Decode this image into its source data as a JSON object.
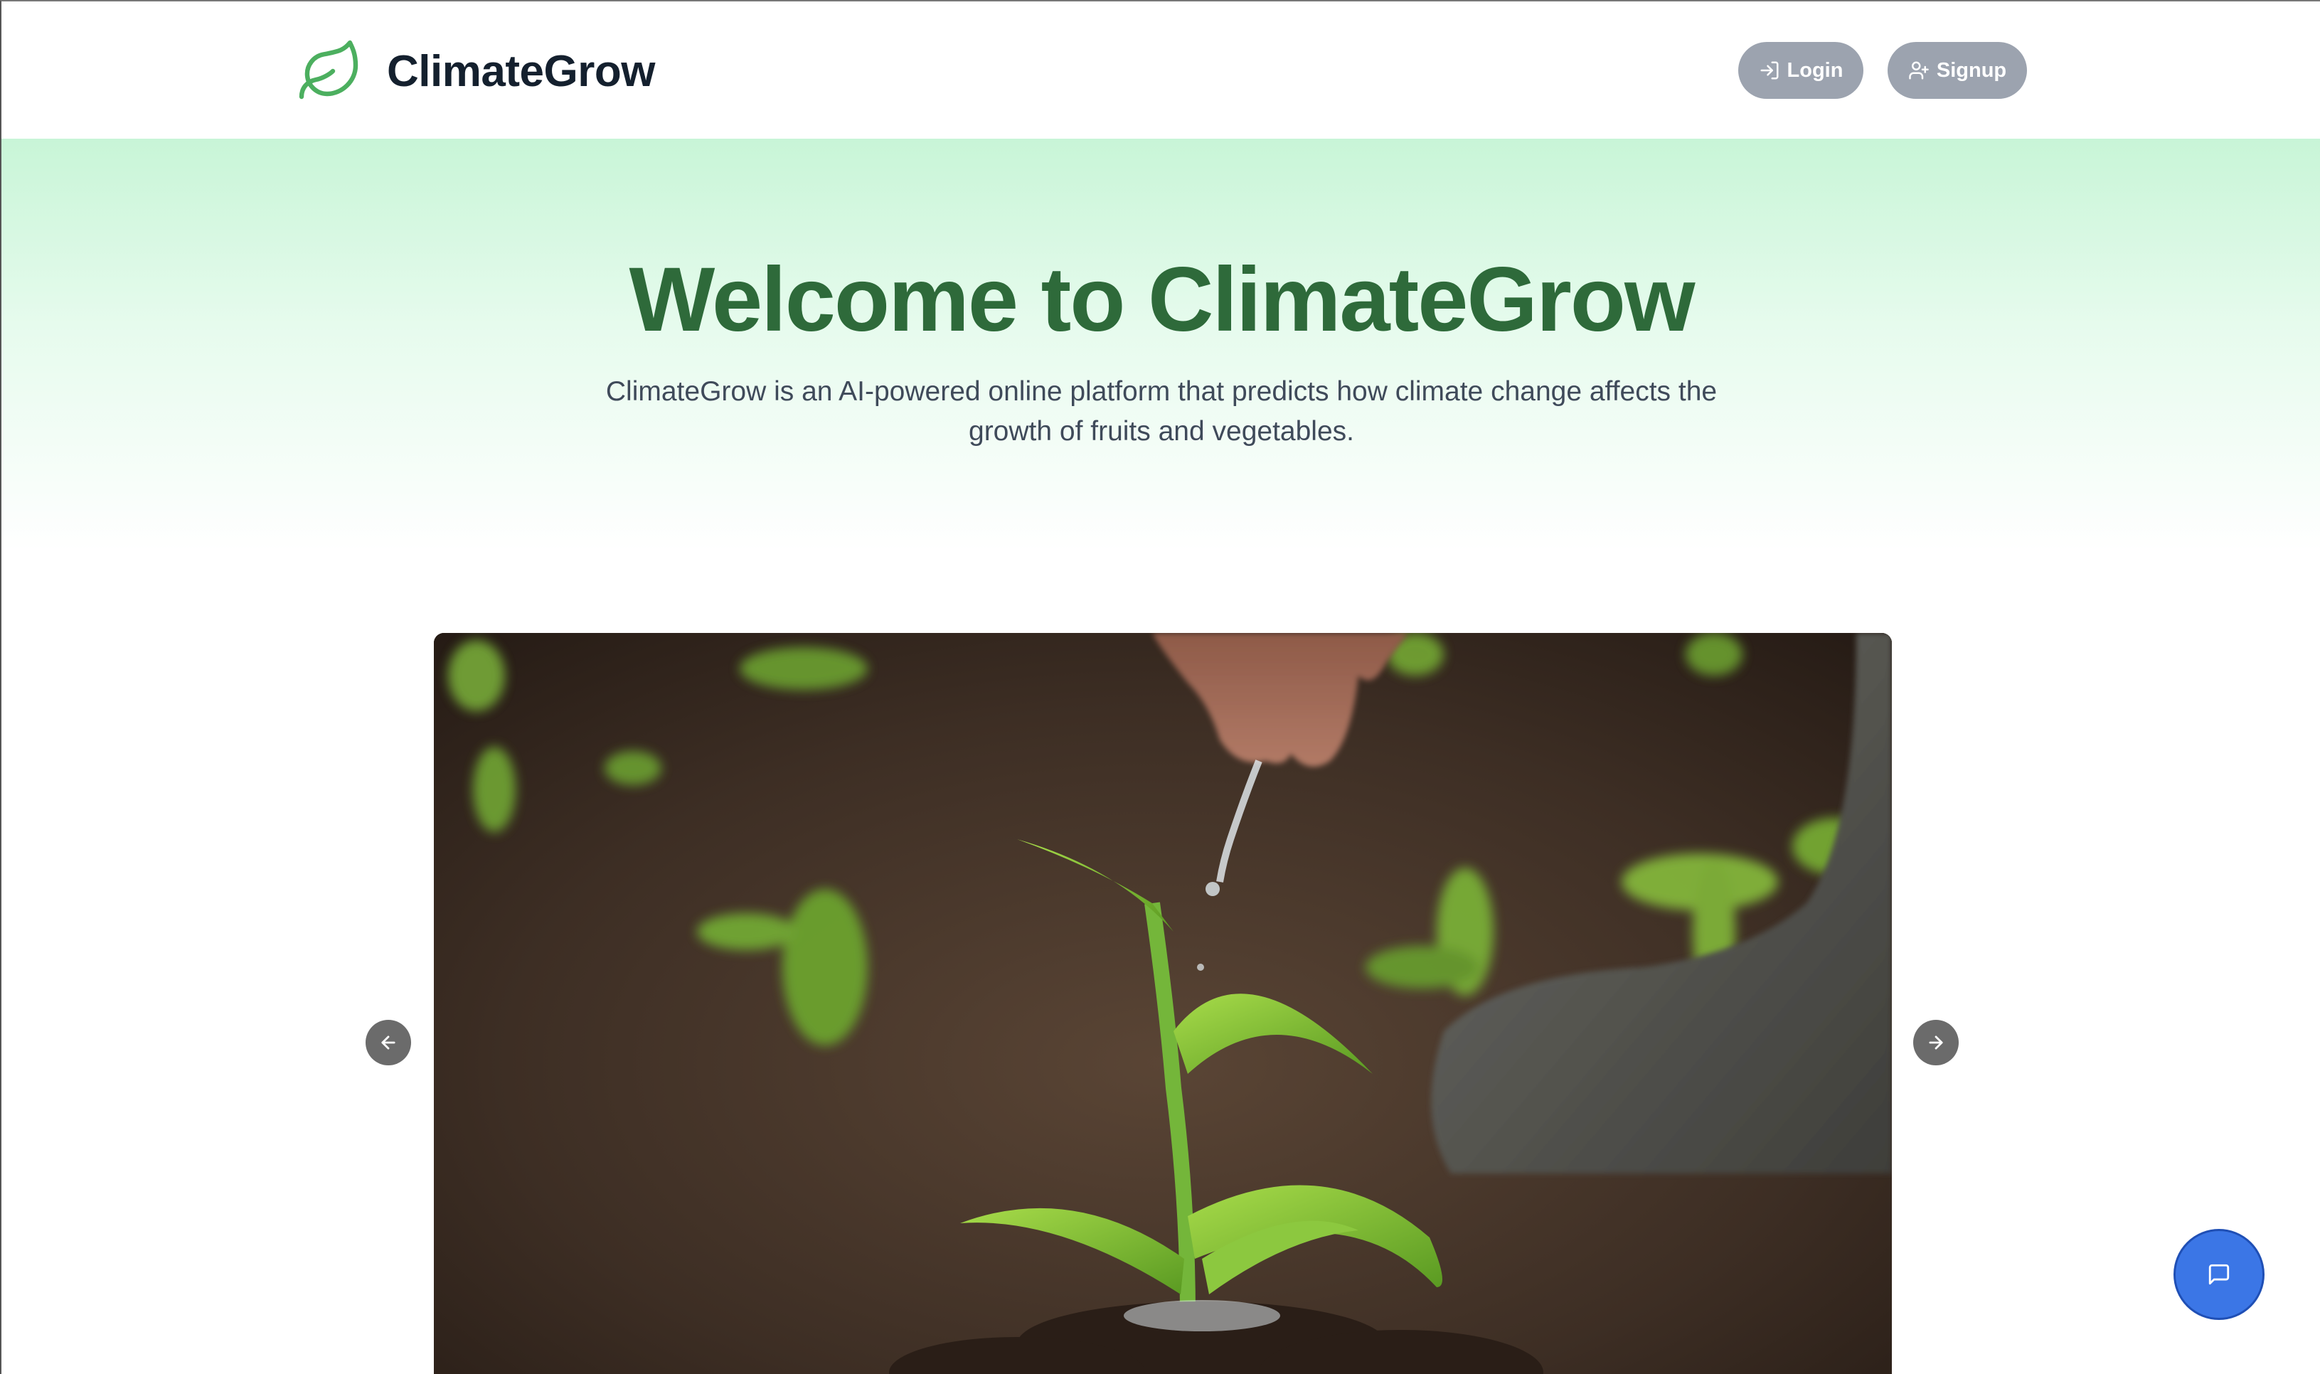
{
  "header": {
    "brand_name": "ClimateGrow",
    "logo_icon": "leaf-icon",
    "login_label": "Login",
    "login_icon": "log-in-icon",
    "signup_label": "Signup",
    "signup_icon": "user-plus-icon"
  },
  "hero": {
    "title": "Welcome to ClimateGrow",
    "subtitle": "ClimateGrow is an AI-powered online platform that predicts how climate change affects the growth of fruits and vegetables."
  },
  "carousel": {
    "prev_icon": "arrow-left-icon",
    "next_icon": "arrow-right-icon",
    "image_alt": "Hand watering a young corn seedling in soil"
  },
  "chat": {
    "icon": "chat-bubble-icon"
  },
  "colors": {
    "brand_green": "#4caf5f",
    "title_green": "#2e6a3a",
    "button_gray": "#9ca3af",
    "chat_blue": "#3b76e6"
  }
}
